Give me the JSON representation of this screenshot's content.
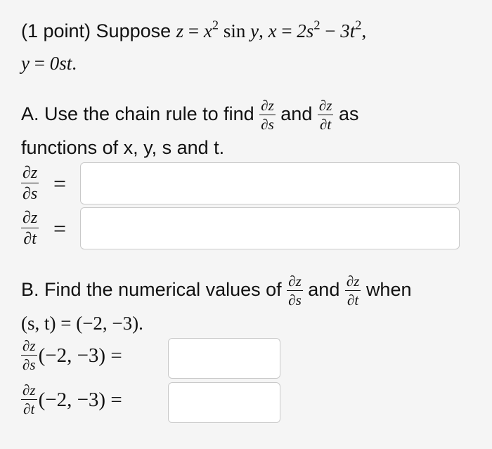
{
  "header": {
    "points": "(1 point) Suppose",
    "z_var": "z",
    "eq": "=",
    "x_var": "x",
    "sq": "2",
    "sin": "sin",
    "y_var": "y",
    "comma1": ",",
    "x_def_lhs": "x",
    "eq2": "=",
    "x_def_rhs_a": "2s",
    "sq2": "2",
    "minus": "−",
    "x_def_rhs_b": "3t",
    "sq3": "2",
    "comma2": ",",
    "line2_y": "y",
    "line2_eq": "=",
    "line2_rhs": "0st",
    "line2_dot": "."
  },
  "part_a": {
    "intro": "A. Use the chain rule to find",
    "and": "and",
    "as": "as",
    "line2": "functions of x, y, s and t.",
    "dz": "∂z",
    "ds": "∂s",
    "dt": "∂t",
    "equals": "=",
    "input_s_value": "",
    "input_t_value": ""
  },
  "part_b": {
    "intro": "B. Find the numerical values of",
    "and": "and",
    "when": "when",
    "point": "(s, t) = (−2, −3).",
    "eval_point": "(−2, −3) =",
    "dz": "∂z",
    "ds": "∂s",
    "dt": "∂t",
    "input_s_value": "",
    "input_t_value": ""
  }
}
